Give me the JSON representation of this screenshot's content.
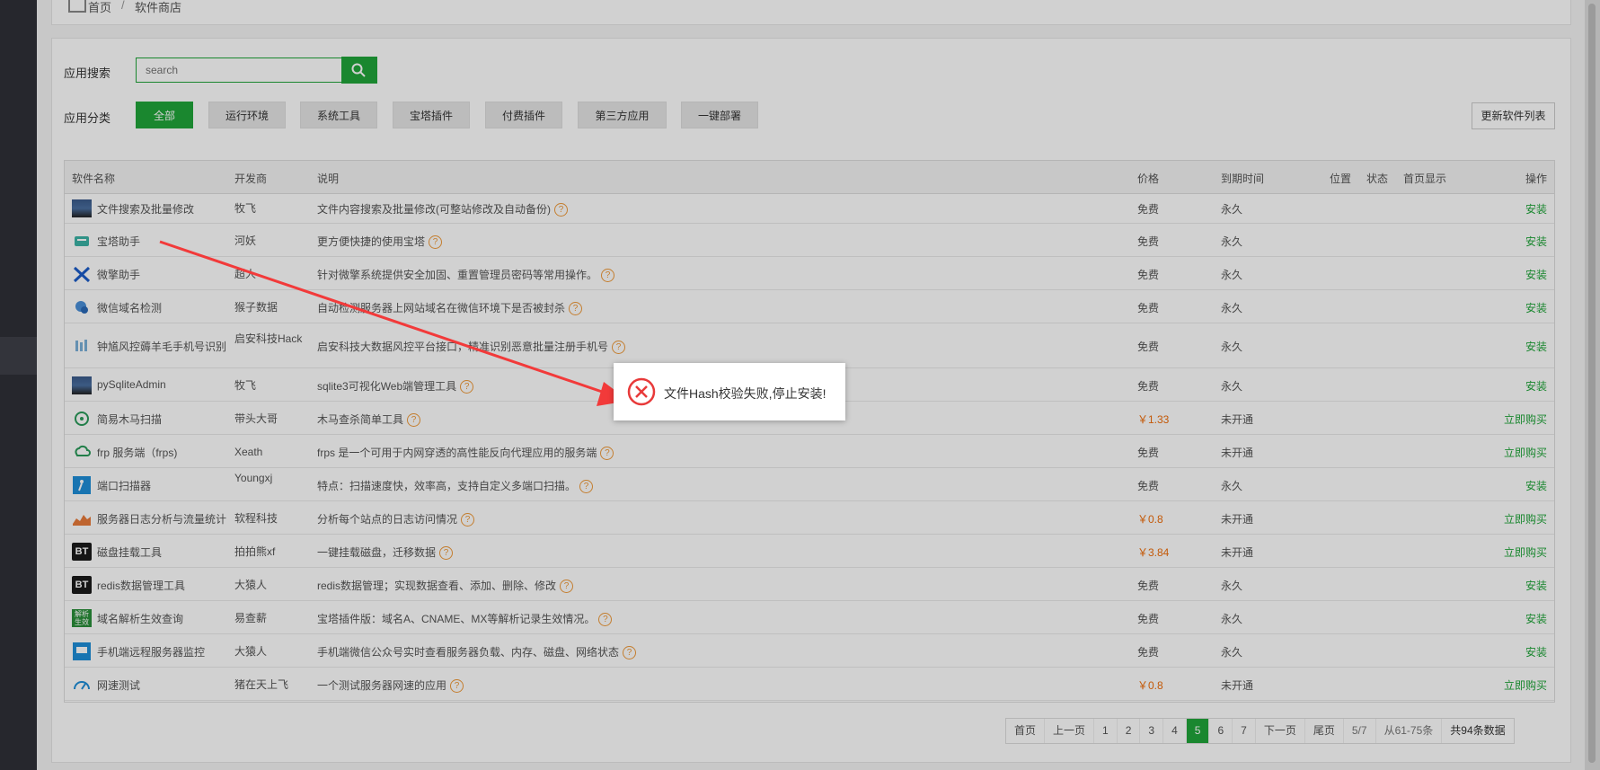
{
  "breadcrumb": {
    "home": "首页",
    "separator": "/",
    "current": "软件商店"
  },
  "search": {
    "label": "应用搜索",
    "placeholder": "search"
  },
  "categories": {
    "label": "应用分类",
    "items": [
      "全部",
      "运行环境",
      "系统工具",
      "宝塔插件",
      "付费插件",
      "第三方应用",
      "一键部署"
    ],
    "active_index": 0
  },
  "refresh_label": "更新软件列表",
  "table": {
    "headers": {
      "name": "软件名称",
      "developer": "开发商",
      "description": "说明",
      "price": "价格",
      "expire": "到期时间",
      "location": "位置",
      "status": "状态",
      "homepage": "首页显示",
      "action": "操作"
    },
    "help_glyph": "?",
    "rows": [
      {
        "icon": "file-search-icon",
        "name": "文件搜索及批量修改",
        "developer": "牧飞",
        "description": "文件内容搜索及批量修改(可整站修改及自动备份)",
        "price": "免费",
        "expire": "永久",
        "action": "安装"
      },
      {
        "icon": "bt-helper-icon",
        "name": "宝塔助手",
        "developer": "河妖",
        "description": "更方便快捷的使用宝塔",
        "price": "免费",
        "expire": "永久",
        "action": "安装"
      },
      {
        "icon": "tools-icon",
        "name": "微擎助手",
        "developer": "超人",
        "description": "针对微擎系统提供安全加固、重置管理员密码等常用操作。",
        "price": "免费",
        "expire": "永久",
        "action": "安装"
      },
      {
        "icon": "domain-check-icon",
        "name": "微信域名检测",
        "developer": "猴子数据",
        "description": "自动检测服务器上网站域名在微信环境下是否被封杀",
        "price": "免费",
        "expire": "永久",
        "action": "安装"
      },
      {
        "icon": "risk-control-icon",
        "name": "钟馗风控薅羊毛手机号识别",
        "developer": "启安科技Hack",
        "description": "启安科技大数据风控平台接口，精准识别恶意批量注册手机号",
        "price": "免费",
        "expire": "永久",
        "action": "安装"
      },
      {
        "icon": "sqlite-admin-icon",
        "name": "pySqliteAdmin",
        "developer": "牧飞",
        "description": "sqlite3可视化Web端管理工具",
        "price": "免费",
        "expire": "永久",
        "action": "安装"
      },
      {
        "icon": "trojan-scan-icon",
        "name": "简易木马扫描",
        "developer": "带头大哥",
        "description": "木马查杀简单工具",
        "price": "￥1.33",
        "expire": "未开通",
        "action": "立即购买"
      },
      {
        "icon": "frp-cloud-icon",
        "name": "frp 服务端（frps)",
        "developer": "Xeath",
        "description": "frps 是一个可用于内网穿透的高性能反向代理应用的服务端",
        "price": "免费",
        "expire": "未开通",
        "action": "立即购买"
      },
      {
        "icon": "port-scan-icon",
        "name": "端口扫描器",
        "developer": "Youngxj",
        "description": "特点：扫描速度快，效率高，支持自定义多端口扫描。",
        "price": "免费",
        "expire": "永久",
        "action": "安装"
      },
      {
        "icon": "log-chart-icon",
        "name": "服务器日志分析与流量统计",
        "developer": "软程科技",
        "description": "分析每个站点的日志访问情况",
        "price": "￥0.8",
        "expire": "未开通",
        "action": "立即购买"
      },
      {
        "icon": "bt-logo-icon",
        "icon_text": "BT",
        "name": "磁盘挂载工具",
        "developer": "拍拍熊xf",
        "description": "一键挂载磁盘，迁移数据",
        "price": "￥3.84",
        "expire": "未开通",
        "action": "立即购买"
      },
      {
        "icon": "bt-logo-icon",
        "icon_text": "BT",
        "name": "redis数据管理工具",
        "developer": "大猿人",
        "description": "redis数据管理；实现数据查看、添加、删除、修改",
        "price": "免费",
        "expire": "永久",
        "action": "安装"
      },
      {
        "icon": "dns-resolve-icon",
        "icon_text": "解析生效",
        "name": "域名解析生效查询",
        "developer": "易查薪",
        "description": "宝塔插件版：域名A、CNAME、MX等解析记录生效情况。",
        "price": "免费",
        "expire": "永久",
        "action": "安装"
      },
      {
        "icon": "mobile-monitor-icon",
        "name": "手机端远程服务器监控",
        "developer": "大猿人",
        "description": "手机端微信公众号实时查看服务器负载、内存、磁盘、网络状态",
        "price": "免费",
        "expire": "永久",
        "action": "安装"
      },
      {
        "icon": "speed-test-icon",
        "name": "网速测试",
        "developer": "猪在天上飞",
        "description": "一个测试服务器网速的应用",
        "price": "￥0.8",
        "expire": "未开通",
        "action": "立即购买"
      }
    ]
  },
  "pagination": {
    "first": "首页",
    "prev": "上一页",
    "pages": [
      "1",
      "2",
      "3",
      "4",
      "5",
      "6",
      "7"
    ],
    "current": "5",
    "next": "下一页",
    "last": "尾页",
    "page_of": "5/7",
    "range": "从61-75条",
    "total": "共94条数据"
  },
  "toast": {
    "icon": "error-circle-icon",
    "message": "文件Hash校验失败,停止安装!"
  },
  "colors": {
    "accent": "#20a53a",
    "paid": "#ef6d0a",
    "error": "#e83a3a",
    "arrow": "#f23a3a"
  }
}
